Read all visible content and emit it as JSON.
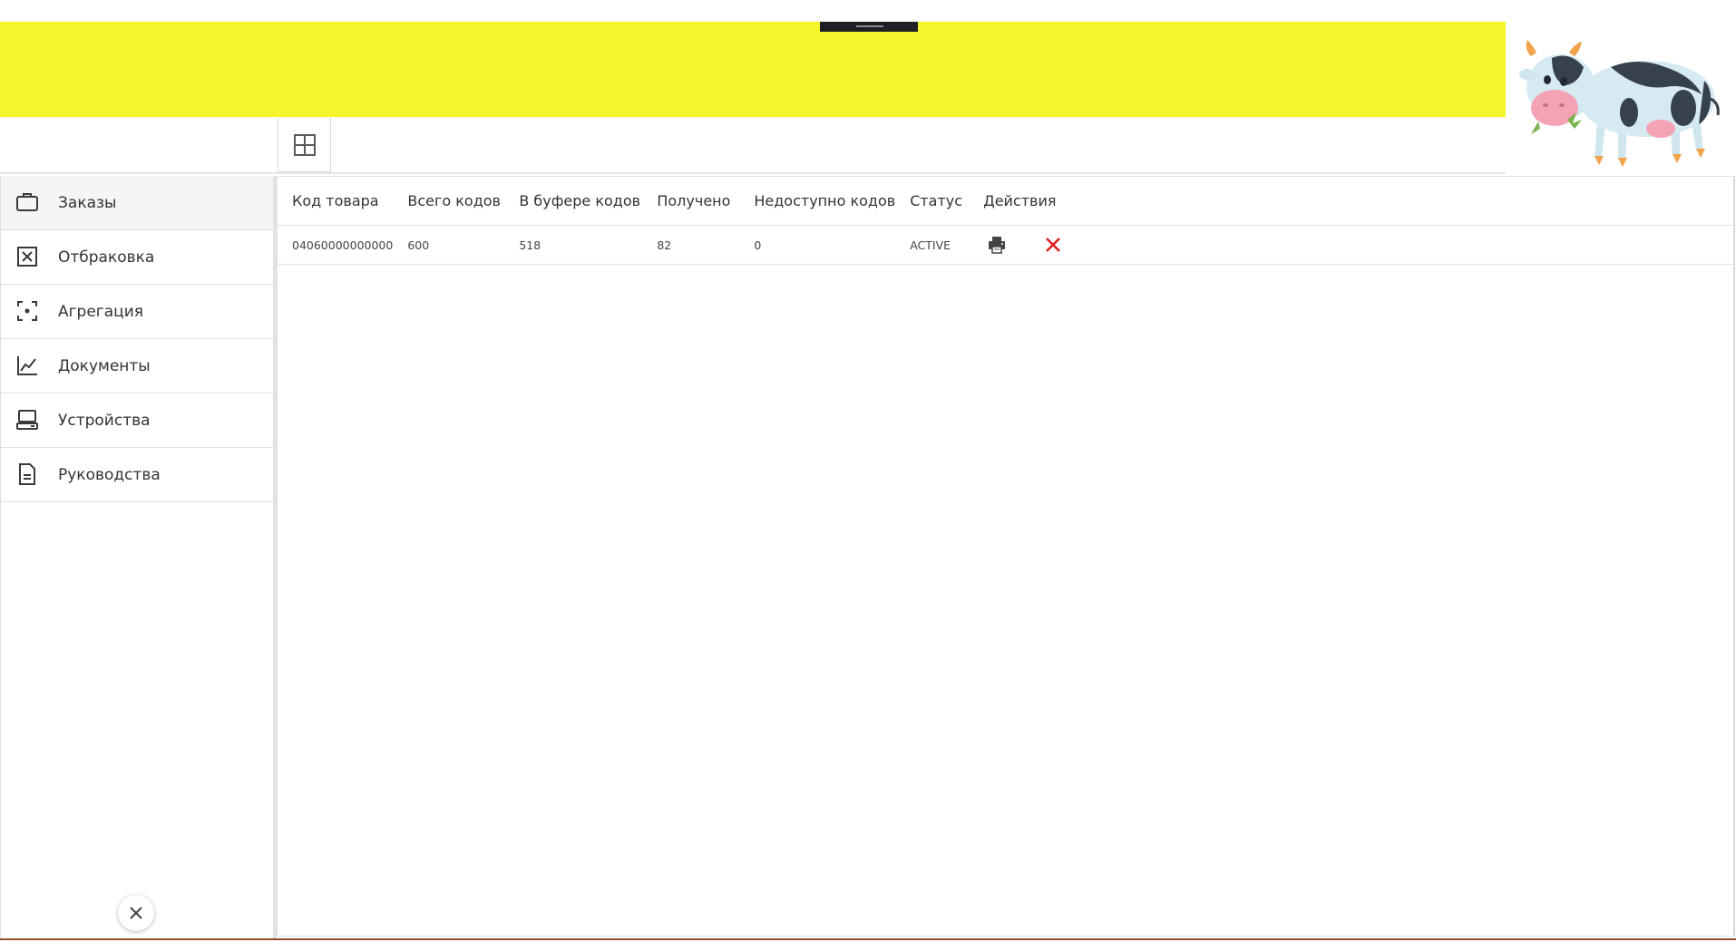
{
  "theme": {
    "banner_color": "#f5f52c",
    "accent_delete": "#e01b1b",
    "bottom_line": "#9a4b2b"
  },
  "mascot": {
    "icon": "cow-mascot"
  },
  "toolbar": {
    "grid_icon": "grid-icon"
  },
  "sidebar": {
    "items": [
      {
        "label": "Заказы",
        "icon": "briefcase-icon",
        "active": true
      },
      {
        "label": "Отбраковка",
        "icon": "reject-box-icon",
        "active": false
      },
      {
        "label": "Агрегация",
        "icon": "aggregation-focus-icon",
        "active": false
      },
      {
        "label": "Документы",
        "icon": "line-chart-icon",
        "active": false
      },
      {
        "label": "Устройства",
        "icon": "device-icon",
        "active": false
      },
      {
        "label": "Руководства",
        "icon": "document-icon",
        "active": false
      }
    ],
    "collapse_icon": "close-icon"
  },
  "table": {
    "columns": [
      "Код товара",
      "Всего кодов",
      "В буфере кодов",
      "Получено",
      "Недоступно кодов",
      "Статус",
      "Действия"
    ],
    "rows": [
      {
        "code": "04060000000000",
        "total": "600",
        "buffer": "518",
        "received": "82",
        "unavailable": "0",
        "status": "ACTIVE",
        "actions": [
          "print-icon",
          "delete-icon"
        ]
      }
    ]
  }
}
